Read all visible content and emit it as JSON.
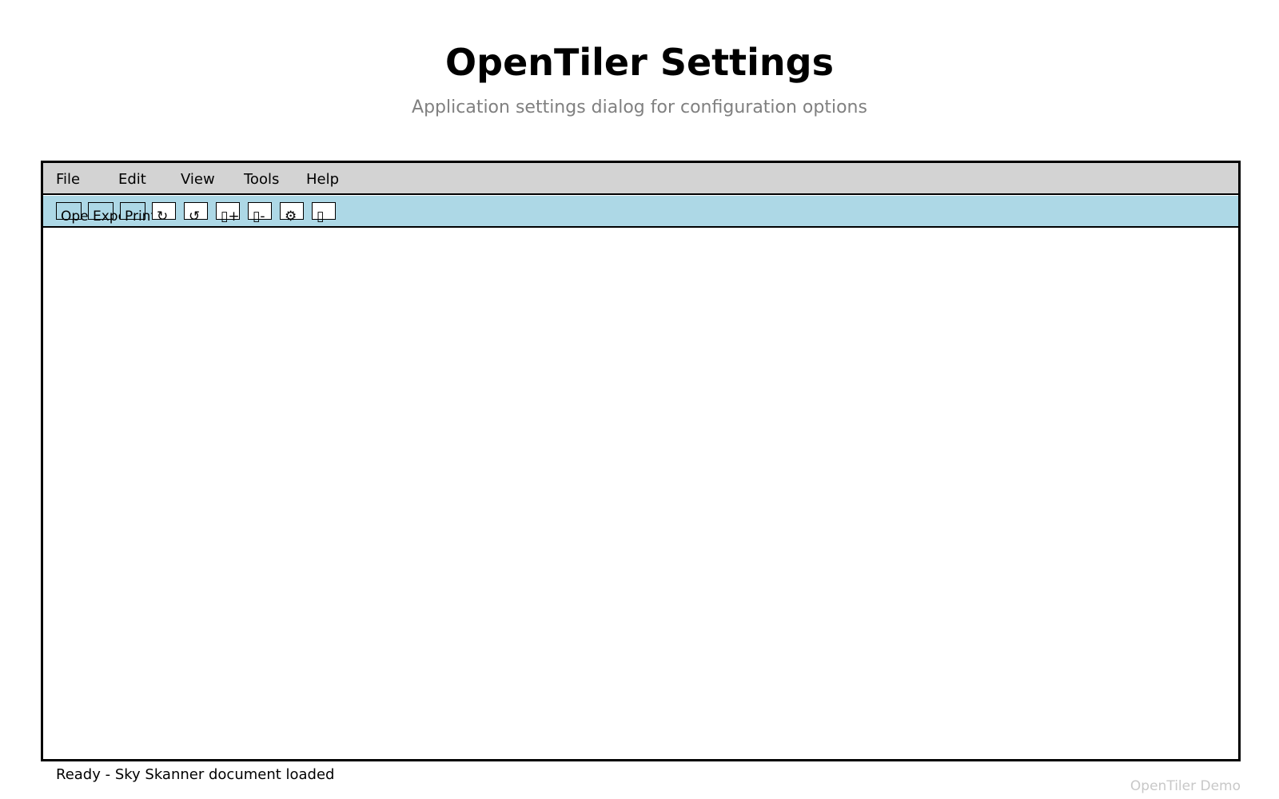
{
  "header": {
    "title": "OpenTiler Settings",
    "subtitle": "Application settings dialog for configuration options"
  },
  "menubar": {
    "items": [
      {
        "label": "File"
      },
      {
        "label": "Edit"
      },
      {
        "label": "View"
      },
      {
        "label": "Tools"
      },
      {
        "label": "Help"
      }
    ]
  },
  "toolbar": {
    "buttons": [
      {
        "label": "Open",
        "icon": "open-icon"
      },
      {
        "label": "Export",
        "icon": "export-icon"
      },
      {
        "label": "Print",
        "icon": "print-icon"
      },
      {
        "label": "↻",
        "icon": "rotate-clockwise-icon"
      },
      {
        "label": "↺",
        "icon": "rotate-counterclockwise-icon"
      },
      {
        "label": "▯+",
        "icon": "zoom-in-icon"
      },
      {
        "label": "▯-",
        "icon": "zoom-out-icon"
      },
      {
        "label": "⚙",
        "icon": "gear-icon"
      },
      {
        "label": "▯",
        "icon": "fit-page-icon"
      }
    ]
  },
  "statusbar": {
    "text": "Ready - Sky Skanner document loaded"
  },
  "footer": {
    "watermark": "OpenTiler Demo"
  }
}
